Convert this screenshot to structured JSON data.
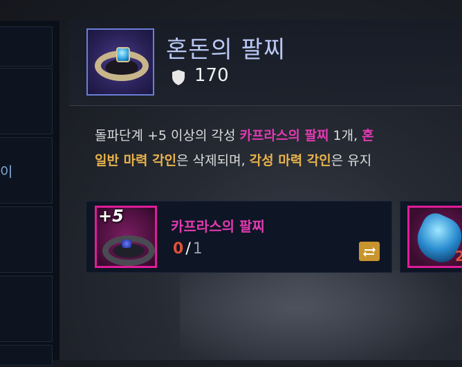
{
  "item": {
    "title": "혼돈의 팔찌",
    "level": "170"
  },
  "description": {
    "line1_a": "돌파단계 +5 이상의 각성 ",
    "line1_b": "카프라스의 팔찌",
    "line1_c": " 1개, ",
    "line1_d": "혼",
    "line2_a": "일반 마력 각인",
    "line2_b": "은 삭제되며, ",
    "line2_c": "각성 마력 각인",
    "line2_d": "은 유지"
  },
  "left_list": {
    "partial_label": "이"
  },
  "materials": [
    {
      "enhance_level": "+5",
      "name": "카프라스의 팔찌",
      "have": "0",
      "separator": "/",
      "need": "1"
    },
    {
      "count_partial": "2"
    }
  ],
  "colors": {
    "accent_pink": "#e23ab2",
    "accent_gold": "#e9b44c",
    "title_blue": "#b9c8f4"
  },
  "icons": {
    "level_icon": "shield-icon",
    "swap_button_icon": "swap-arrows-icon"
  }
}
